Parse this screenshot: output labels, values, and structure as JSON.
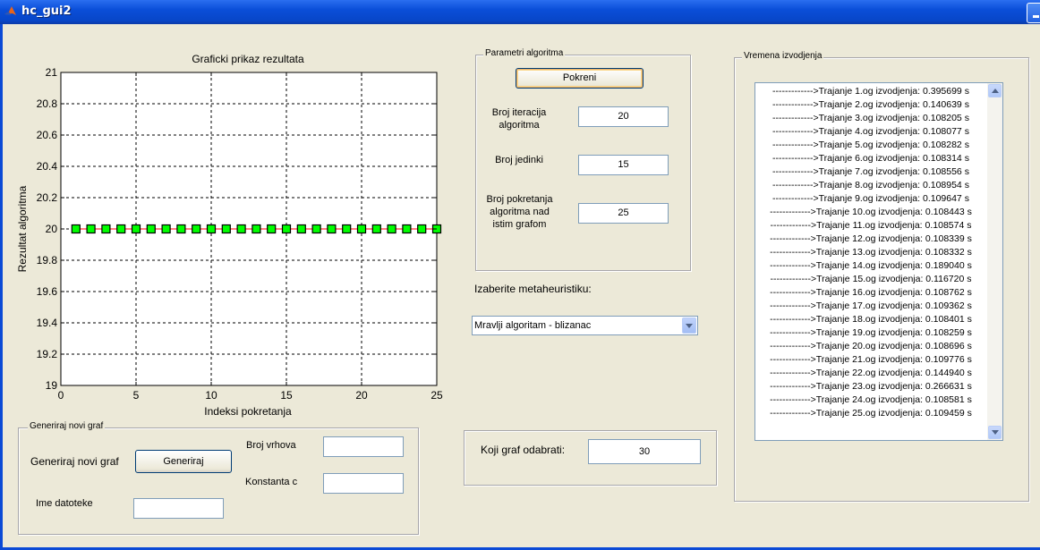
{
  "window": {
    "title": "hc_gui2"
  },
  "chart_data": {
    "type": "scatter",
    "title": "Graficki prikaz rezultata",
    "xlabel": "Indeksi pokretanja",
    "ylabel": "Rezultat algoritma",
    "xlim": [
      0,
      25
    ],
    "ylim": [
      19,
      21
    ],
    "xticks": [
      0,
      5,
      10,
      15,
      20,
      25
    ],
    "yticks": [
      19,
      19.2,
      19.4,
      19.6,
      19.8,
      20,
      20.2,
      20.4,
      20.6,
      20.8,
      21
    ],
    "grid": true,
    "marker": "square",
    "marker_color": "#00ff00",
    "line_color": "#ff0000",
    "x": [
      1,
      2,
      3,
      4,
      5,
      6,
      7,
      8,
      9,
      10,
      11,
      12,
      13,
      14,
      15,
      16,
      17,
      18,
      19,
      20,
      21,
      22,
      23,
      24,
      25
    ],
    "y": [
      20,
      20,
      20,
      20,
      20,
      20,
      20,
      20,
      20,
      20,
      20,
      20,
      20,
      20,
      20,
      20,
      20,
      20,
      20,
      20,
      20,
      20,
      20,
      20,
      20
    ]
  },
  "params": {
    "panel_title": "Parametri algoritma",
    "run_button": "Pokreni",
    "iterations_label": "Broj iteracija\nalgoritma",
    "iterations_value": "20",
    "population_label": "Broj jedinki",
    "population_value": "15",
    "runs_label": "Broj pokretanja\nalgoritma nad\nistim grafom",
    "runs_value": "25"
  },
  "metaheuristic": {
    "label": "Izaberite metaheuristiku:",
    "selected": "Mravlji algoritam - blizanac"
  },
  "graph_select": {
    "label": "Koji graf odabrati:",
    "value": "30"
  },
  "generate": {
    "panel_title": "Generiraj novi graf",
    "label": "Generiraj novi graf",
    "button": "Generiraj",
    "vertices_label": "Broj vrhova",
    "vertices_value": "",
    "constant_label": "Konstanta c",
    "constant_value": "",
    "filename_label": "Ime datoteke",
    "filename_value": ""
  },
  "times": {
    "panel_title": "Vremena izvodjenja",
    "items": [
      "------------->Trajanje 1.og izvodjenja: 0.395699 s",
      "------------->Trajanje 2.og izvodjenja: 0.140639 s",
      "------------->Trajanje 3.og izvodjenja: 0.108205 s",
      "------------->Trajanje 4.og izvodjenja: 0.108077 s",
      "------------->Trajanje 5.og izvodjenja: 0.108282 s",
      "------------->Trajanje 6.og izvodjenja: 0.108314 s",
      "------------->Trajanje 7.og izvodjenja: 0.108556 s",
      "------------->Trajanje 8.og izvodjenja: 0.108954 s",
      "------------->Trajanje 9.og izvodjenja: 0.109647 s",
      "------------->Trajanje 10.og izvodjenja: 0.108443 s",
      "------------->Trajanje 11.og izvodjenja: 0.108574 s",
      "------------->Trajanje 12.og izvodjenja: 0.108339 s",
      "------------->Trajanje 13.og izvodjenja: 0.108332 s",
      "------------->Trajanje 14.og izvodjenja: 0.189040 s",
      "------------->Trajanje 15.og izvodjenja: 0.116720 s",
      "------------->Trajanje 16.og izvodjenja: 0.108762 s",
      "------------->Trajanje 17.og izvodjenja: 0.109362 s",
      "------------->Trajanje 18.og izvodjenja: 0.108401 s",
      "------------->Trajanje 19.og izvodjenja: 0.108259 s",
      "------------->Trajanje 20.og izvodjenja: 0.108696 s",
      "------------->Trajanje 21.og izvodjenja: 0.109776 s",
      "------------->Trajanje 22.og izvodjenja: 0.144940 s",
      "------------->Trajanje 23.og izvodjenja: 0.266631 s",
      "------------->Trajanje 24.og izvodjenja: 0.108581 s",
      "------------->Trajanje 25.og izvodjenja: 0.109459 s"
    ]
  }
}
